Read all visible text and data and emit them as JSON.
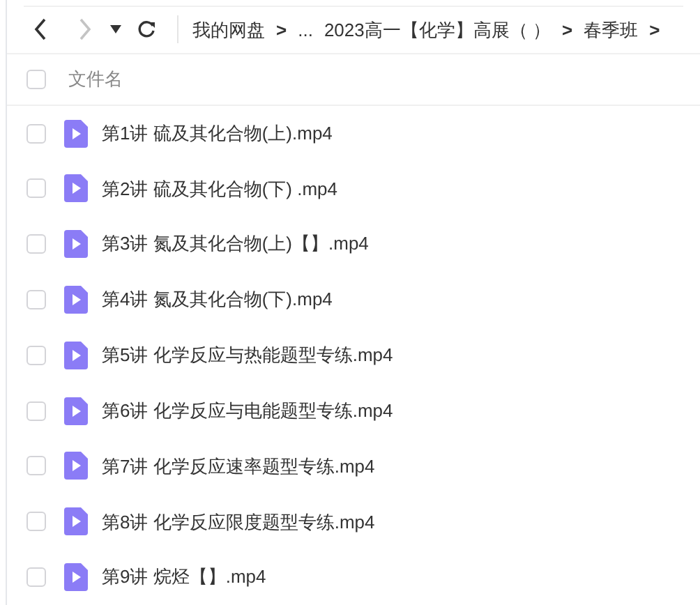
{
  "nav": {
    "back": {
      "disabled": false
    },
    "forward": {
      "disabled": true
    }
  },
  "breadcrumb": [
    {
      "kind": "folder",
      "label": "我的网盘"
    },
    {
      "kind": "separator",
      "label": ">"
    },
    {
      "kind": "folder",
      "label": "..."
    },
    {
      "kind": "folder",
      "label": "2023高一【化学】高展（  ）"
    },
    {
      "kind": "separator",
      "label": ">"
    },
    {
      "kind": "folder",
      "label": "春季班"
    },
    {
      "kind": "separator",
      "label": ">"
    }
  ],
  "table": {
    "header": {
      "label": "文件名",
      "checked": false
    },
    "rows": [
      {
        "name": "第1讲 硫及其化合物(上).mp4",
        "checked": false
      },
      {
        "name": "第2讲 硫及其化合物(下) .mp4",
        "checked": false
      },
      {
        "name": "第3讲 氮及其化合物(上)【】.mp4",
        "checked": false
      },
      {
        "name": "第4讲 氮及其化合物(下).mp4",
        "checked": false
      },
      {
        "name": "第5讲 化学反应与热能题型专练.mp4",
        "checked": false
      },
      {
        "name": "第6讲 化学反应与电能题型专练.mp4",
        "checked": false
      },
      {
        "name": "第7讲 化学反应速率题型专练.mp4",
        "checked": false
      },
      {
        "name": "第8讲 化学反应限度题型专练.mp4",
        "checked": false
      },
      {
        "name": "第9讲 烷烃【】.mp4",
        "checked": false
      }
    ]
  }
}
